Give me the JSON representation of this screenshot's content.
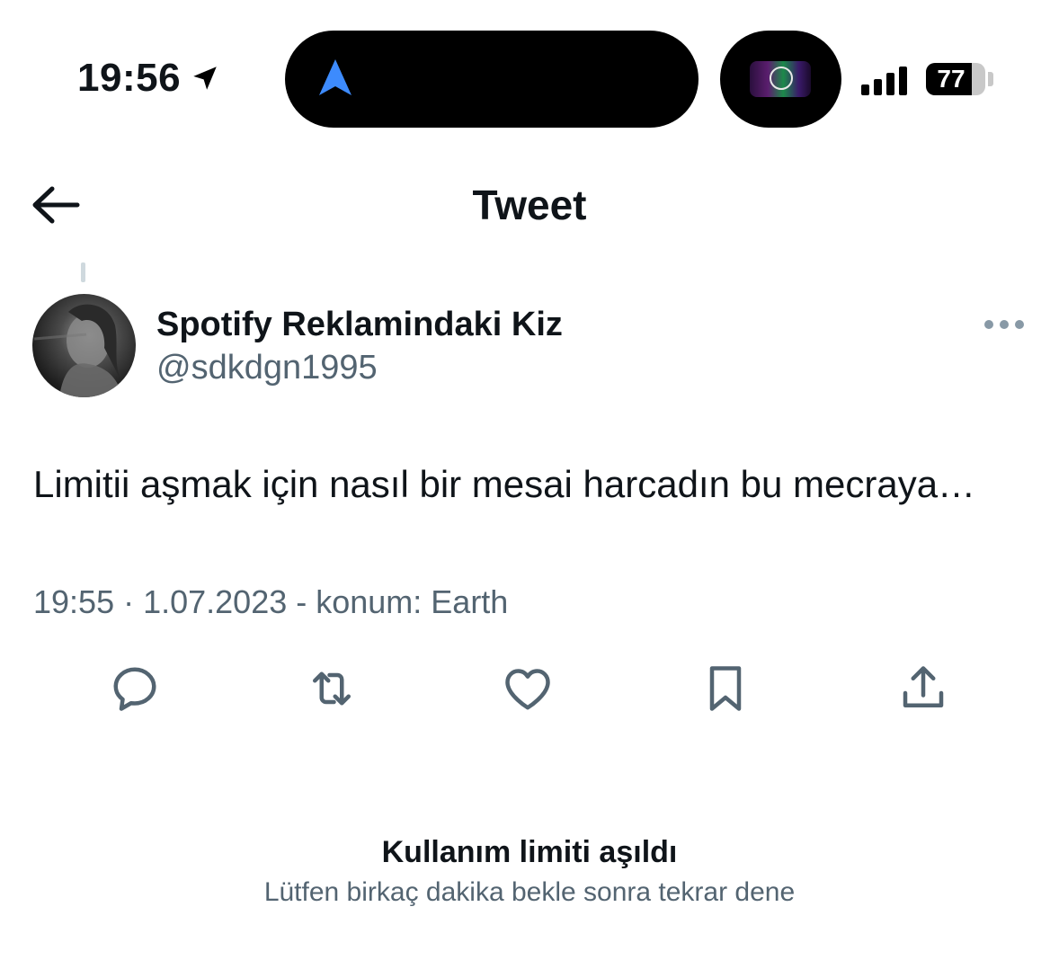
{
  "status_bar": {
    "time": "19:56",
    "location_icon": "location-arrow-icon",
    "battery_level": 77,
    "battery_text": "77",
    "signal_bars": 4
  },
  "header": {
    "title": "Tweet",
    "back_icon": "arrow-left-icon"
  },
  "tweet": {
    "author_name": "Spotify Reklamindaki Kiz",
    "author_handle": "@sdkdgn1995",
    "text": "Limitii aşmak için nasıl bir mesai harcadın bu mecraya…",
    "meta": "19:55 · 1.07.2023 - konum: Earth",
    "more_icon": "more-dots-icon"
  },
  "actions": [
    {
      "name": "reply",
      "icon": "reply-icon"
    },
    {
      "name": "retweet",
      "icon": "retweet-icon"
    },
    {
      "name": "like",
      "icon": "heart-icon"
    },
    {
      "name": "bookmark",
      "icon": "bookmark-icon"
    },
    {
      "name": "share",
      "icon": "share-icon"
    }
  ],
  "limit_notice": {
    "title": "Kullanım limiti aşıldı",
    "subtitle": "Lütfen birkaç dakika bekle sonra tekrar dene"
  },
  "colors": {
    "text_primary": "#0f1419",
    "text_secondary": "#536471",
    "navigation_blue": "#3d8bfd",
    "thread_line": "#cfd9de"
  }
}
